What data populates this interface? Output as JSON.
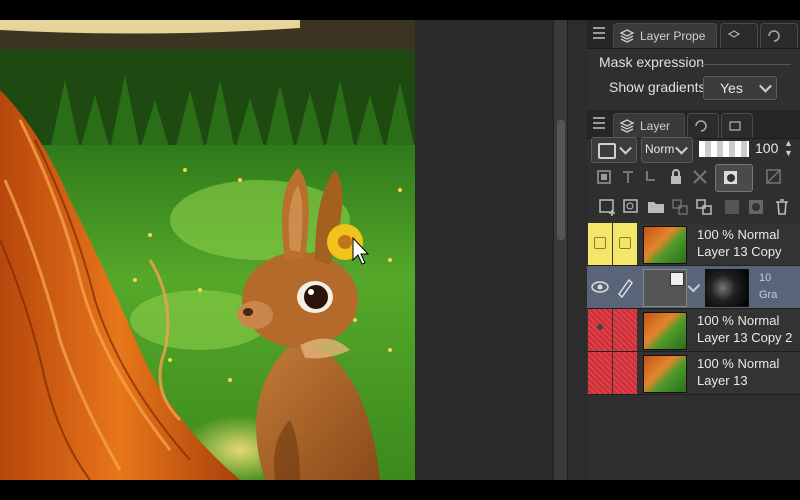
{
  "panel": {
    "property_tab_label": "Layer Prope",
    "layer_tab_label": "Layer",
    "mask_expression_label": "Mask expression",
    "show_gradients_label": "Show gradients",
    "show_gradients_value": "Yes",
    "blend_mode_value": "Norm",
    "opacity_value": "100"
  },
  "layers": [
    {
      "mode": "100 % Normal",
      "name": "Layer 13 Copy",
      "marker": "yellow"
    },
    {
      "mode": "10",
      "name": "Gra",
      "marker": "none",
      "selected": true
    },
    {
      "mode": "100 % Normal",
      "name": "Layer 13 Copy 2",
      "marker": "red"
    },
    {
      "mode": "100 % Normal",
      "name": "Layer 13",
      "marker": "red"
    }
  ],
  "colors": {
    "panel_bg": "#2f2f2f",
    "selected_row": "#5a6478",
    "yellow_marker": "#f3e66a",
    "red_marker": "#e0404a"
  },
  "icons": [
    "menu-icon",
    "layer-property-icon",
    "layers-icon",
    "eye-icon",
    "pen-icon",
    "lock-icon",
    "trash-icon",
    "new-layer-icon",
    "folder-icon",
    "cursor-icon"
  ]
}
